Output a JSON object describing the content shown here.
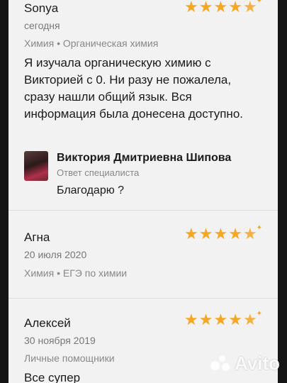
{
  "reviews": [
    {
      "name": "Sonya",
      "date": "сегодня",
      "category": "Химия • Органическая химия",
      "text_lines": [
        "Я изучала органическую химию с",
        "Викторией с 0. Ни разу не пожалела,",
        "сразу нашли общий язык. Вся",
        "информация была донесена доступно."
      ],
      "rating": 5
    },
    {
      "name": "Агна",
      "date": "20 июля 2020",
      "category": "Химия • ЕГЭ по химии",
      "rating": 5
    },
    {
      "name": "Алексей",
      "date": "30 ноября 2019",
      "category": "Личные помощники",
      "text": "Все супер",
      "rating": 5
    }
  ],
  "reply": {
    "name": "Виктория Дмитриевна Шипова",
    "role": "Ответ специалиста",
    "text": "Благодарю ?"
  },
  "watermark": "Avito",
  "colors": {
    "star": "#f5a623",
    "card": "#f2f2f2"
  }
}
